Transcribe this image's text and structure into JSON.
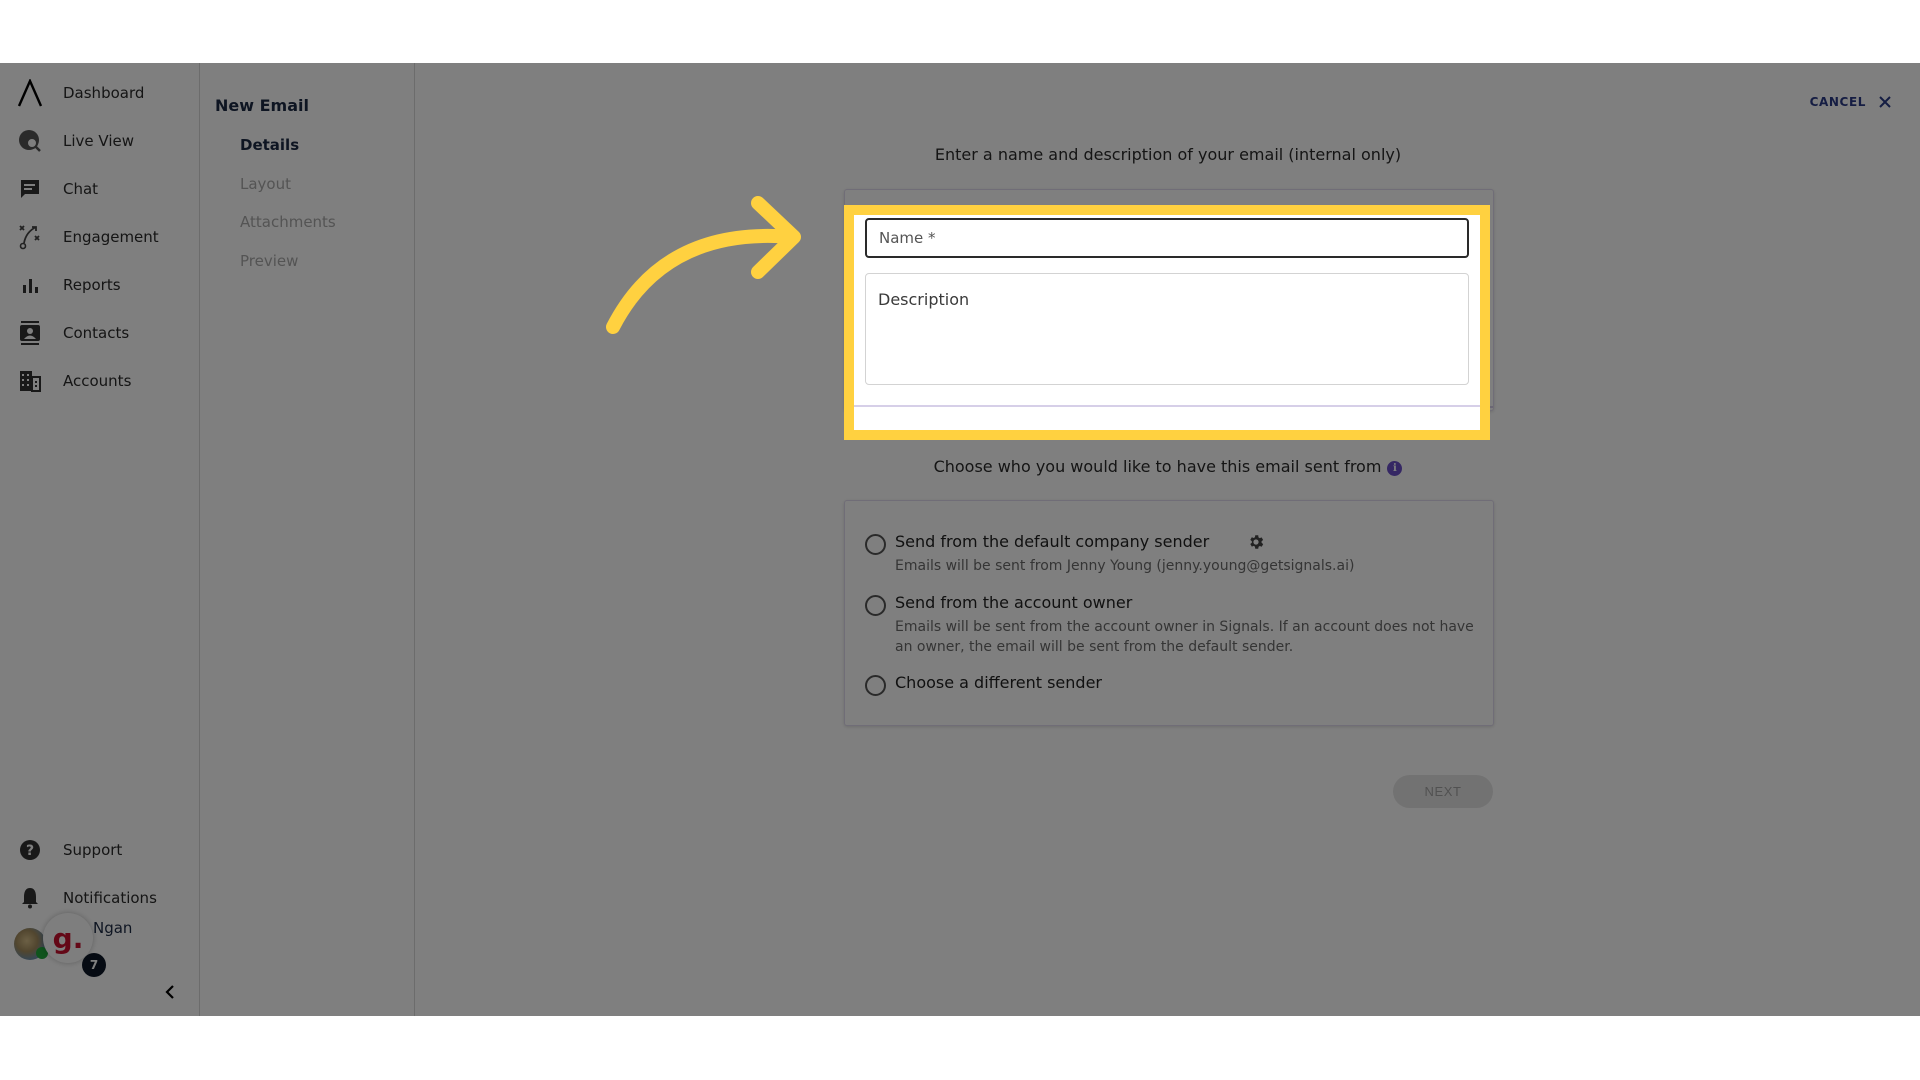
{
  "sidebar": {
    "items": [
      {
        "label": "Dashboard",
        "icon": "logo-caret-icon"
      },
      {
        "label": "Live View",
        "icon": "globe-search-icon"
      },
      {
        "label": "Chat",
        "icon": "chat-icon"
      },
      {
        "label": "Engagement",
        "icon": "play-strategy-icon"
      },
      {
        "label": "Reports",
        "icon": "bar-chart-icon"
      },
      {
        "label": "Contacts",
        "icon": "contact-card-icon"
      },
      {
        "label": "Accounts",
        "icon": "building-icon"
      }
    ],
    "bottom_items": [
      {
        "label": "Support",
        "icon": "help-icon"
      },
      {
        "label": "Notifications",
        "icon": "bell-icon"
      }
    ],
    "user": {
      "name": "Ngan",
      "bubble_letter": "g.",
      "badge_count": "7"
    }
  },
  "steps": {
    "title": "New Email",
    "items": [
      {
        "label": "Details",
        "active": true
      },
      {
        "label": "Layout",
        "active": false
      },
      {
        "label": "Attachments",
        "active": false
      },
      {
        "label": "Preview",
        "active": false
      }
    ]
  },
  "main": {
    "cancel_label": "CANCEL",
    "details_heading": "Enter a name and description of your email (internal only)",
    "name_field": {
      "placeholder": "Name *",
      "value": ""
    },
    "description_field": {
      "placeholder": "Description",
      "value": ""
    },
    "sender_heading": "Choose who you would like to have this email sent from",
    "sender_options": [
      {
        "label": "Send from the default company sender",
        "description": "Emails will be sent from Jenny Young (jenny.young@getsignals.ai)",
        "selected": false
      },
      {
        "label": "Send from the account owner",
        "description": "Emails will be sent from the account owner in Signals. If an account does not have an owner, the email will be sent from the default sender.",
        "selected": false
      },
      {
        "label": "Choose a different sender",
        "description": "",
        "selected": false
      }
    ],
    "next_label": "NEXT"
  },
  "annotation": {
    "highlight_color": "#ffd140"
  }
}
